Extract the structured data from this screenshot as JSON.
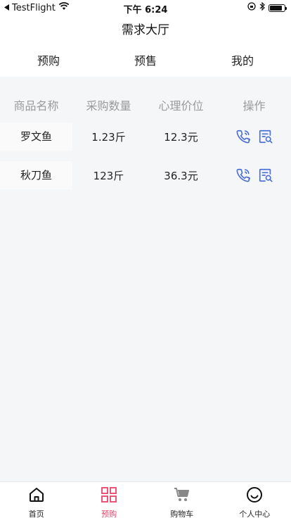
{
  "status_bar": {
    "back_app": "TestFlight",
    "time": "下午 6:24"
  },
  "header": {
    "title": "需求大厅"
  },
  "tabs": [
    {
      "label": "预购"
    },
    {
      "label": "预售"
    },
    {
      "label": "我的"
    }
  ],
  "table": {
    "columns": [
      "商品名称",
      "采购数量",
      "心理价位",
      "操作"
    ],
    "rows": [
      {
        "name": "罗文鱼",
        "quantity": "1.23斤",
        "price": "12.3元"
      },
      {
        "name": "秋刀鱼",
        "quantity": "123斤",
        "price": "36.3元"
      }
    ]
  },
  "bottom_nav": [
    {
      "label": "首页",
      "icon": "home-icon"
    },
    {
      "label": "预购",
      "icon": "grid-icon",
      "active": true
    },
    {
      "label": "购物车",
      "icon": "cart-icon"
    },
    {
      "label": "个人中心",
      "icon": "smile-icon"
    }
  ],
  "colors": {
    "accent": "#e8446a",
    "action_icon": "#4a6fd6",
    "background": "#f5f6f8"
  }
}
